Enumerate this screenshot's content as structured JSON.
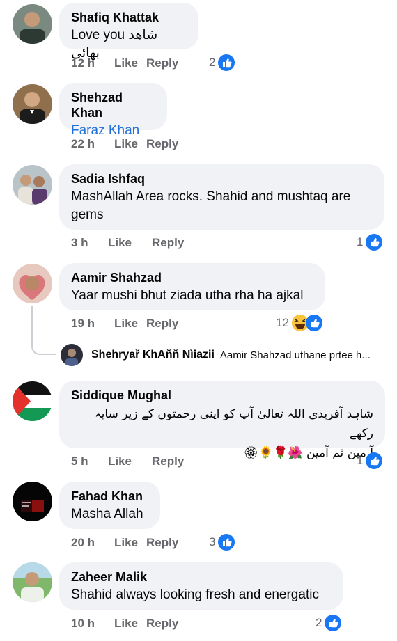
{
  "comments": [
    {
      "name": "Shafiq Khattak",
      "text": "Love you شاھد بھائی",
      "time": "12 h",
      "like": "Like",
      "reply": "Reply",
      "reaction_count": "2"
    },
    {
      "name": "Shehzad Khan",
      "text": "Faraz Khan",
      "time": "22 h",
      "like": "Like",
      "reply": "Reply"
    },
    {
      "name": "Sadia Ishfaq",
      "text_line1": "MashAllah Area rocks. Shahid and mushtaq are",
      "text_line2": "gems",
      "time": "3 h",
      "like": "Like",
      "reply": "Reply",
      "reaction_count": "1"
    },
    {
      "name": "Aamir Shahzad",
      "text": "Yaar mushi bhut ziada utha rha ha ajkal",
      "time": "19 h",
      "like": "Like",
      "reply": "Reply",
      "reaction_count": "12"
    },
    {
      "name": "Siddique Mughal",
      "text_line1": "شاہد آفریدی اللہ تعالیٰ آپ کو اپنی رحمتوں کے زیر سایہ رکھے",
      "text_line2": "آ مین ثم آمین 🌺🌹🌻🏵",
      "time": "5 h",
      "like": "Like",
      "reply": "Reply",
      "reaction_count": "1"
    },
    {
      "name": "Fahad Khan",
      "text": "Masha Allah",
      "time": "20 h",
      "like": "Like",
      "reply": "Reply",
      "reaction_count": "3"
    },
    {
      "name": "Zaheer Malik",
      "text": "Shahid always looking fresh and energatic",
      "time": "10 h",
      "like": "Like",
      "reply": "Reply",
      "reaction_count": "2"
    }
  ],
  "reply_preview": {
    "name": "Shehryař KhAňň Nìiazii",
    "text": "Aamir Shahzad uthane prtee h..."
  },
  "colors": {
    "bubble": "#f0f2f5",
    "meta": "#65676b",
    "link": "#216fdb",
    "like_blue": "#1877f2"
  }
}
